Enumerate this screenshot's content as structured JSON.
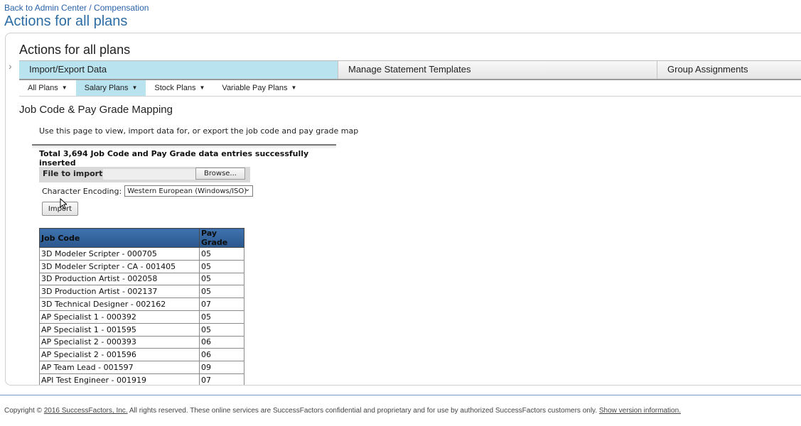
{
  "header": {
    "breadcrumb": "Back to Admin Center / Compensation",
    "title": "Actions for all plans"
  },
  "panel": {
    "title": "Actions for all plans",
    "tabs": [
      {
        "label": "Import/Export Data",
        "active": true
      },
      {
        "label": "Manage Statement Templates",
        "active": false
      },
      {
        "label": "Group Assignments",
        "active": false
      }
    ],
    "subnav": [
      {
        "label": "All Plans",
        "active": false
      },
      {
        "label": "Salary Plans",
        "active": true
      },
      {
        "label": "Stock Plans",
        "active": false
      },
      {
        "label": "Variable Pay Plans",
        "active": false
      }
    ]
  },
  "mapping": {
    "section_title": "Job Code & Pay Grade Mapping",
    "description": "Use this page to view, import data for, or export the job code and pay grade map",
    "success_message": "Total 3,694 Job Code and Pay Grade data entries successfully inserted",
    "file_label": "File to import:",
    "browse_label": "Browse...",
    "encoding_label": "Character Encoding:",
    "encoding_value": "Western European (Windows/ISO)",
    "import_label": "Import"
  },
  "table": {
    "headers": [
      "Job Code",
      "Pay Grade"
    ],
    "rows": [
      [
        "3D Modeler Scripter - 000705",
        "05"
      ],
      [
        "3D Modeler Scripter - CA - 001405",
        "05"
      ],
      [
        "3D Production Artist - 002058",
        "05"
      ],
      [
        "3D Production Artist - 002137",
        "05"
      ],
      [
        "3D Technical Designer - 002162",
        "07"
      ],
      [
        "AP Specialist 1 - 000392",
        "05"
      ],
      [
        "AP Specialist 1 - 001595",
        "05"
      ],
      [
        "AP Specialist 2 - 000393",
        "06"
      ],
      [
        "AP Specialist 2 - 001596",
        "06"
      ],
      [
        "AP Team Lead - 001597",
        "09"
      ],
      [
        "API Test Engineer - 001919",
        "07"
      ],
      [
        "",
        ""
      ]
    ]
  },
  "footer": {
    "copyright_prefix": "Copyright ©",
    "company_link": "2016 SuccessFactors, Inc.",
    "rights_text": "All rights reserved. These online services are SuccessFactors confidential and proprietary and for use by authorized SuccessFactors customers only.",
    "version_link": "Show version information."
  },
  "colors": {
    "accent": "#2e6da4",
    "active_tab": "#b8e3ef",
    "table_header": "#2d5e95"
  }
}
